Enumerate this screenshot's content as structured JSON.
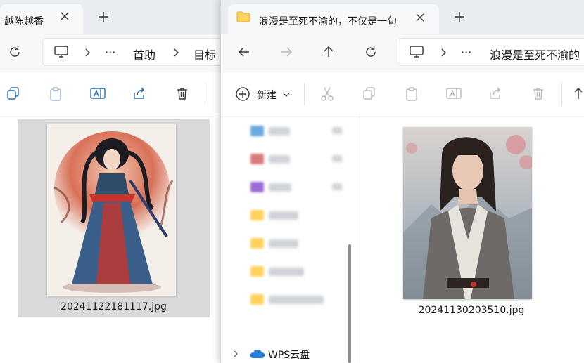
{
  "left_window": {
    "tab": {
      "title": "越陈越香",
      "close_icon": "close-icon"
    },
    "new_tab_icon": "plus-icon",
    "nav": {
      "refresh_icon": "refresh-icon"
    },
    "breadcrumb": {
      "pc_icon": "monitor-icon",
      "ellipsis": "···",
      "items": [
        "首助",
        "目标"
      ]
    },
    "toolbar": {
      "icons": [
        "copy-icon",
        "paste-icon",
        "rename-icon",
        "share-icon",
        "delete-icon"
      ]
    },
    "file": {
      "name": "20241122181117.jpg",
      "selected": true
    }
  },
  "right_window": {
    "tab": {
      "title": "浪漫是至死不渝的，不仅是一句",
      "folder_icon": "folder-icon",
      "close_icon": "close-icon"
    },
    "new_tab_icon": "plus-icon",
    "nav": {
      "back_icon": "arrow-left-icon",
      "forward_icon": "arrow-right-icon",
      "up_icon": "arrow-up-icon",
      "refresh_icon": "refresh-icon"
    },
    "breadcrumb": {
      "pc_icon": "monitor-icon",
      "ellipsis": "···",
      "items": [
        "浪漫是至死不渝的"
      ]
    },
    "toolbar": {
      "new_label": "新建",
      "icons": [
        "cut-icon",
        "copy-icon",
        "paste-icon",
        "rename-icon",
        "share-icon",
        "delete-icon",
        "sort-icon"
      ]
    },
    "nav_pane": {
      "blurred_items": 7,
      "cloud": {
        "label": "WPS云盘",
        "icon": "cloud-icon"
      }
    },
    "file": {
      "name": "20241130203510.jpg"
    }
  },
  "colors": {
    "tabstrip": "#e9ecf1",
    "tab": "#f7f8fa",
    "selection": "#d9d9d9",
    "folder": "#ffd35c",
    "cloud": "#2a7bd6"
  }
}
